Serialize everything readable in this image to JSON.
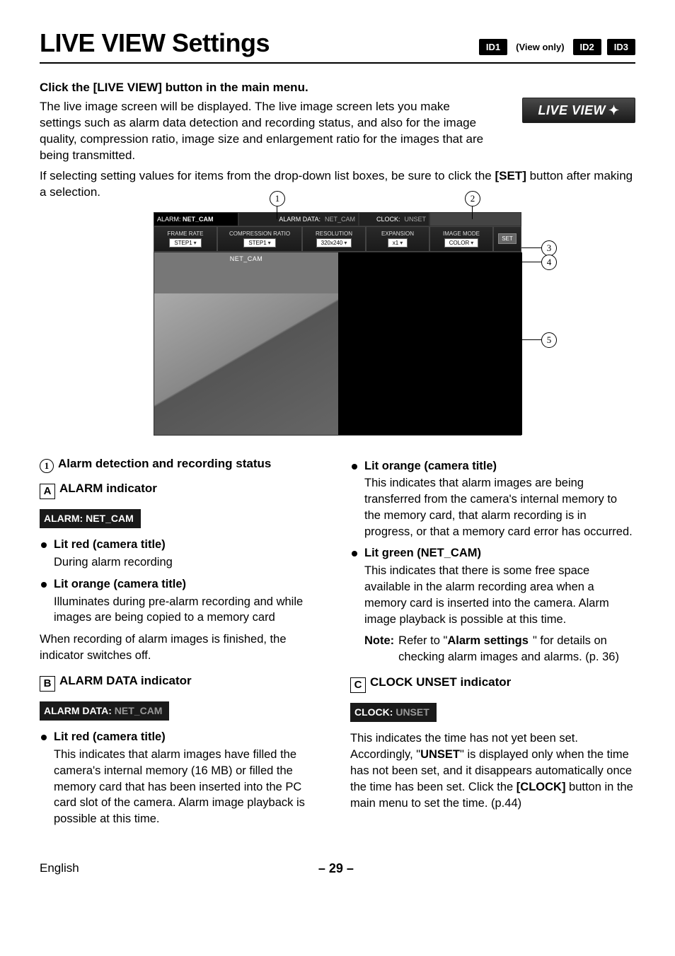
{
  "header": {
    "title": "LIVE VIEW Settings",
    "id1": "ID1",
    "viewonly": "(View only)",
    "id2": "ID2",
    "id3": "ID3"
  },
  "intro": {
    "lead": "Click the [LIVE VIEW] button in the main menu.",
    "para1": "The live image screen will be displayed. The live image screen lets you make settings such as alarm data detection and recording status, and also for the image quality, compression ratio, image size and enlargement ratio for the images that are being transmitted.",
    "para2_a": "If selecting setting values for items from the drop-down list boxes, be sure to click the ",
    "para2_b": "[SET]",
    "para2_c": " button after making a selection.",
    "liveview_btn": "LIVE VIEW"
  },
  "figure": {
    "alarm_label": "ALARM:",
    "alarm_value": "NET_CAM",
    "alarmdata_label": "ALARM DATA:",
    "alarmdata_value": "NET_CAM",
    "clock_label": "CLOCK:",
    "clock_value": "UNSET",
    "cols": {
      "framerate": {
        "head": "FRAME RATE",
        "val": "STEP1"
      },
      "compression": {
        "head": "COMPRESSION RATIO",
        "val": "STEP1"
      },
      "resolution": {
        "head": "RESOLUTION",
        "val": "320x240"
      },
      "expansion": {
        "head": "EXPANSION",
        "val": "x1"
      },
      "imagemode": {
        "head": "IMAGE MODE",
        "val": "COLOR"
      }
    },
    "set_btn": "SET",
    "cam_title": "NET_CAM",
    "callouts": {
      "c1": "1",
      "c2": "2",
      "c3": "3",
      "c4": "4",
      "c5": "5"
    }
  },
  "left": {
    "h1_num": "1",
    "h1": "Alarm detection and recording status",
    "A_letter": "A",
    "A_title": "ALARM indicator",
    "A_strip_a": "ALARM:",
    "A_strip_b": "NET_CAM",
    "A_b1_head": "Lit red (camera title)",
    "A_b1_body": "During alarm recording",
    "A_b2_head": "Lit orange (camera title)",
    "A_b2_body": "Illuminates during pre-alarm recording and while images are being copied to a memory card",
    "A_para": "When recording of alarm images is finished, the indicator switches off.",
    "B_letter": "B",
    "B_title": "ALARM DATA indicator",
    "B_strip_a": "ALARM DATA:",
    "B_strip_b": "NET_CAM",
    "B_b1_head": "Lit red (camera title)",
    "B_b1_body": "This indicates that alarm images have filled the camera's internal memory (16 MB) or filled the memory card that has been inserted into the PC card slot of the camera. Alarm image playback is possible at this time."
  },
  "right": {
    "b1_head": "Lit orange (camera title)",
    "b1_body": "This indicates that alarm images are being transferred from the camera's internal memory to the memory card, that alarm recording is in progress, or that a memory card error has occurred.",
    "b2_head": "Lit green (NET_CAM)",
    "b2_body": "This indicates that there is some free space available in the alarm recording area when a memory card is inserted into the camera. Alarm image playback is possible at this time.",
    "note_label": "Note:",
    "note_a": "Refer to \"",
    "note_b": "Alarm settings",
    "note_c": "\" for details on checking alarm images and alarms. (p. 36)",
    "C_letter": "C",
    "C_title": "CLOCK UNSET indicator",
    "C_strip_a": "CLOCK:",
    "C_strip_b": "UNSET",
    "C_para_a": "This indicates the time has not yet been set. Accordingly, \"",
    "C_para_b": "UNSET",
    "C_para_c": "\" is displayed only when the time has not been set, and it disappears automatically once the time has been set. Click the ",
    "C_para_d": "[CLOCK]",
    "C_para_e": " button in the main menu to set the time. (p.44)"
  },
  "footer": {
    "lang": "English",
    "page": "– 29 –"
  }
}
